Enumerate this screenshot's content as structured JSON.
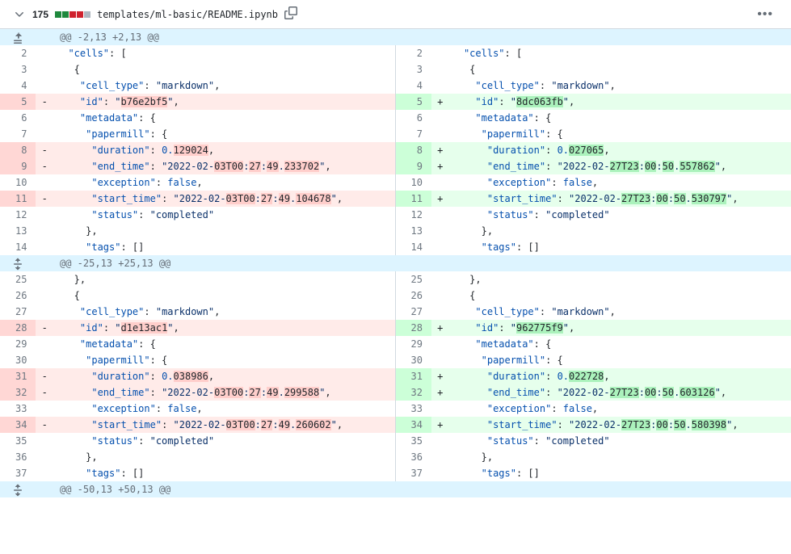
{
  "header": {
    "change_count": "175",
    "file_path": "templates/ml-basic/README.ipynb",
    "diffstat": [
      "add",
      "add",
      "del",
      "del",
      "neu"
    ]
  },
  "hunks": [
    {
      "label": "@@ -2,13 +2,13 @@",
      "expand_kind": "up",
      "rows": [
        {
          "l": 2,
          "r": 2,
          "t": "ctx",
          "tok": [
            [
              "w",
              "  "
            ],
            [
              "k",
              "\"cells\""
            ],
            [
              "p",
              ": ["
            ]
          ]
        },
        {
          "l": 3,
          "r": 3,
          "t": "ctx",
          "tok": [
            [
              "w",
              "   "
            ],
            [
              "p",
              "{"
            ]
          ]
        },
        {
          "l": 4,
          "r": 4,
          "t": "ctx",
          "tok": [
            [
              "w",
              "    "
            ],
            [
              "k",
              "\"cell_type\""
            ],
            [
              "p",
              ": "
            ],
            [
              "s",
              "\"markdown\""
            ],
            [
              "p",
              ","
            ]
          ]
        },
        {
          "l": 5,
          "r": 5,
          "t": "chg",
          "lt": [
            [
              "w",
              "    "
            ],
            [
              "k",
              "\"id\""
            ],
            [
              "p",
              ": "
            ],
            [
              "s",
              "\""
            ],
            [
              "hd",
              "b76e2bf5"
            ],
            [
              "s",
              "\""
            ],
            [
              "p",
              ","
            ]
          ],
          "rt": [
            [
              "w",
              "    "
            ],
            [
              "k",
              "\"id\""
            ],
            [
              "p",
              ": "
            ],
            [
              "s",
              "\""
            ],
            [
              "ha",
              "8dc063fb"
            ],
            [
              "s",
              "\""
            ],
            [
              "p",
              ","
            ]
          ]
        },
        {
          "l": 6,
          "r": 6,
          "t": "ctx",
          "tok": [
            [
              "w",
              "    "
            ],
            [
              "k",
              "\"metadata\""
            ],
            [
              "p",
              ": {"
            ]
          ]
        },
        {
          "l": 7,
          "r": 7,
          "t": "ctx",
          "tok": [
            [
              "w",
              "     "
            ],
            [
              "k",
              "\"papermill\""
            ],
            [
              "p",
              ": {"
            ]
          ]
        },
        {
          "l": 8,
          "r": 8,
          "t": "chg",
          "lt": [
            [
              "w",
              "      "
            ],
            [
              "k",
              "\"duration\""
            ],
            [
              "p",
              ": "
            ],
            [
              "n",
              "0."
            ],
            [
              "hd",
              "129024"
            ],
            [
              "p",
              ","
            ]
          ],
          "rt": [
            [
              "w",
              "      "
            ],
            [
              "k",
              "\"duration\""
            ],
            [
              "p",
              ": "
            ],
            [
              "n",
              "0."
            ],
            [
              "ha",
              "027065"
            ],
            [
              "p",
              ","
            ]
          ]
        },
        {
          "l": 9,
          "r": 9,
          "t": "chg",
          "lt": [
            [
              "w",
              "      "
            ],
            [
              "k",
              "\"end_time\""
            ],
            [
              "p",
              ": "
            ],
            [
              "s",
              "\"2022-02-"
            ],
            [
              "hd",
              "03T00"
            ],
            [
              "s",
              ":"
            ],
            [
              "hd",
              "27"
            ],
            [
              "s",
              ":"
            ],
            [
              "hd",
              "49"
            ],
            [
              "s",
              "."
            ],
            [
              "hd",
              "233702"
            ],
            [
              "s",
              "\""
            ],
            [
              "p",
              ","
            ]
          ],
          "rt": [
            [
              "w",
              "      "
            ],
            [
              "k",
              "\"end_time\""
            ],
            [
              "p",
              ": "
            ],
            [
              "s",
              "\"2022-02-"
            ],
            [
              "ha",
              "27T23"
            ],
            [
              "s",
              ":"
            ],
            [
              "ha",
              "00"
            ],
            [
              "s",
              ":"
            ],
            [
              "ha",
              "50"
            ],
            [
              "s",
              "."
            ],
            [
              "ha",
              "557862"
            ],
            [
              "s",
              "\""
            ],
            [
              "p",
              ","
            ]
          ]
        },
        {
          "l": 10,
          "r": 10,
          "t": "ctx",
          "tok": [
            [
              "w",
              "      "
            ],
            [
              "k",
              "\"exception\""
            ],
            [
              "p",
              ": "
            ],
            [
              "b",
              "false"
            ],
            [
              "p",
              ","
            ]
          ]
        },
        {
          "l": 11,
          "r": 11,
          "t": "chg",
          "lt": [
            [
              "w",
              "      "
            ],
            [
              "k",
              "\"start_time\""
            ],
            [
              "p",
              ": "
            ],
            [
              "s",
              "\"2022-02-"
            ],
            [
              "hd",
              "03T00"
            ],
            [
              "s",
              ":"
            ],
            [
              "hd",
              "27"
            ],
            [
              "s",
              ":"
            ],
            [
              "hd",
              "49"
            ],
            [
              "s",
              "."
            ],
            [
              "hd",
              "104678"
            ],
            [
              "s",
              "\""
            ],
            [
              "p",
              ","
            ]
          ],
          "rt": [
            [
              "w",
              "      "
            ],
            [
              "k",
              "\"start_time\""
            ],
            [
              "p",
              ": "
            ],
            [
              "s",
              "\"2022-02-"
            ],
            [
              "ha",
              "27T23"
            ],
            [
              "s",
              ":"
            ],
            [
              "ha",
              "00"
            ],
            [
              "s",
              ":"
            ],
            [
              "ha",
              "50"
            ],
            [
              "s",
              "."
            ],
            [
              "ha",
              "530797"
            ],
            [
              "s",
              "\""
            ],
            [
              "p",
              ","
            ]
          ]
        },
        {
          "l": 12,
          "r": 12,
          "t": "ctx",
          "tok": [
            [
              "w",
              "      "
            ],
            [
              "k",
              "\"status\""
            ],
            [
              "p",
              ": "
            ],
            [
              "s",
              "\"completed\""
            ]
          ]
        },
        {
          "l": 13,
          "r": 13,
          "t": "ctx",
          "tok": [
            [
              "w",
              "     "
            ],
            [
              "p",
              "},"
            ]
          ]
        },
        {
          "l": 14,
          "r": 14,
          "t": "ctx",
          "tok": [
            [
              "w",
              "     "
            ],
            [
              "k",
              "\"tags\""
            ],
            [
              "p",
              ": []"
            ]
          ]
        }
      ]
    },
    {
      "label": "@@ -25,13 +25,13 @@",
      "expand_kind": "both",
      "rows": [
        {
          "l": 25,
          "r": 25,
          "t": "ctx",
          "tok": [
            [
              "w",
              "   "
            ],
            [
              "p",
              "},"
            ]
          ]
        },
        {
          "l": 26,
          "r": 26,
          "t": "ctx",
          "tok": [
            [
              "w",
              "   "
            ],
            [
              "p",
              "{"
            ]
          ]
        },
        {
          "l": 27,
          "r": 27,
          "t": "ctx",
          "tok": [
            [
              "w",
              "    "
            ],
            [
              "k",
              "\"cell_type\""
            ],
            [
              "p",
              ": "
            ],
            [
              "s",
              "\"markdown\""
            ],
            [
              "p",
              ","
            ]
          ]
        },
        {
          "l": 28,
          "r": 28,
          "t": "chg",
          "lt": [
            [
              "w",
              "    "
            ],
            [
              "k",
              "\"id\""
            ],
            [
              "p",
              ": "
            ],
            [
              "s",
              "\""
            ],
            [
              "hd",
              "d1e13ac1"
            ],
            [
              "s",
              "\""
            ],
            [
              "p",
              ","
            ]
          ],
          "rt": [
            [
              "w",
              "    "
            ],
            [
              "k",
              "\"id\""
            ],
            [
              "p",
              ": "
            ],
            [
              "s",
              "\""
            ],
            [
              "ha",
              "962775f9"
            ],
            [
              "s",
              "\""
            ],
            [
              "p",
              ","
            ]
          ]
        },
        {
          "l": 29,
          "r": 29,
          "t": "ctx",
          "tok": [
            [
              "w",
              "    "
            ],
            [
              "k",
              "\"metadata\""
            ],
            [
              "p",
              ": {"
            ]
          ]
        },
        {
          "l": 30,
          "r": 30,
          "t": "ctx",
          "tok": [
            [
              "w",
              "     "
            ],
            [
              "k",
              "\"papermill\""
            ],
            [
              "p",
              ": {"
            ]
          ]
        },
        {
          "l": 31,
          "r": 31,
          "t": "chg",
          "lt": [
            [
              "w",
              "      "
            ],
            [
              "k",
              "\"duration\""
            ],
            [
              "p",
              ": "
            ],
            [
              "n",
              "0."
            ],
            [
              "hd",
              "038986"
            ],
            [
              "p",
              ","
            ]
          ],
          "rt": [
            [
              "w",
              "      "
            ],
            [
              "k",
              "\"duration\""
            ],
            [
              "p",
              ": "
            ],
            [
              "n",
              "0."
            ],
            [
              "ha",
              "022728"
            ],
            [
              "p",
              ","
            ]
          ]
        },
        {
          "l": 32,
          "r": 32,
          "t": "chg",
          "lt": [
            [
              "w",
              "      "
            ],
            [
              "k",
              "\"end_time\""
            ],
            [
              "p",
              ": "
            ],
            [
              "s",
              "\"2022-02-"
            ],
            [
              "hd",
              "03T00"
            ],
            [
              "s",
              ":"
            ],
            [
              "hd",
              "27"
            ],
            [
              "s",
              ":"
            ],
            [
              "hd",
              "49"
            ],
            [
              "s",
              "."
            ],
            [
              "hd",
              "299588"
            ],
            [
              "s",
              "\""
            ],
            [
              "p",
              ","
            ]
          ],
          "rt": [
            [
              "w",
              "      "
            ],
            [
              "k",
              "\"end_time\""
            ],
            [
              "p",
              ": "
            ],
            [
              "s",
              "\"2022-02-"
            ],
            [
              "ha",
              "27T23"
            ],
            [
              "s",
              ":"
            ],
            [
              "ha",
              "00"
            ],
            [
              "s",
              ":"
            ],
            [
              "ha",
              "50"
            ],
            [
              "s",
              "."
            ],
            [
              "ha",
              "603126"
            ],
            [
              "s",
              "\""
            ],
            [
              "p",
              ","
            ]
          ]
        },
        {
          "l": 33,
          "r": 33,
          "t": "ctx",
          "tok": [
            [
              "w",
              "      "
            ],
            [
              "k",
              "\"exception\""
            ],
            [
              "p",
              ": "
            ],
            [
              "b",
              "false"
            ],
            [
              "p",
              ","
            ]
          ]
        },
        {
          "l": 34,
          "r": 34,
          "t": "chg",
          "lt": [
            [
              "w",
              "      "
            ],
            [
              "k",
              "\"start_time\""
            ],
            [
              "p",
              ": "
            ],
            [
              "s",
              "\"2022-02-"
            ],
            [
              "hd",
              "03T00"
            ],
            [
              "s",
              ":"
            ],
            [
              "hd",
              "27"
            ],
            [
              "s",
              ":"
            ],
            [
              "hd",
              "49"
            ],
            [
              "s",
              "."
            ],
            [
              "hd",
              "260602"
            ],
            [
              "s",
              "\""
            ],
            [
              "p",
              ","
            ]
          ],
          "rt": [
            [
              "w",
              "      "
            ],
            [
              "k",
              "\"start_time\""
            ],
            [
              "p",
              ": "
            ],
            [
              "s",
              "\"2022-02-"
            ],
            [
              "ha",
              "27T23"
            ],
            [
              "s",
              ":"
            ],
            [
              "ha",
              "00"
            ],
            [
              "s",
              ":"
            ],
            [
              "ha",
              "50"
            ],
            [
              "s",
              "."
            ],
            [
              "ha",
              "580398"
            ],
            [
              "s",
              "\""
            ],
            [
              "p",
              ","
            ]
          ]
        },
        {
          "l": 35,
          "r": 35,
          "t": "ctx",
          "tok": [
            [
              "w",
              "      "
            ],
            [
              "k",
              "\"status\""
            ],
            [
              "p",
              ": "
            ],
            [
              "s",
              "\"completed\""
            ]
          ]
        },
        {
          "l": 36,
          "r": 36,
          "t": "ctx",
          "tok": [
            [
              "w",
              "     "
            ],
            [
              "p",
              "},"
            ]
          ]
        },
        {
          "l": 37,
          "r": 37,
          "t": "ctx",
          "tok": [
            [
              "w",
              "     "
            ],
            [
              "k",
              "\"tags\""
            ],
            [
              "p",
              ": []"
            ]
          ]
        }
      ]
    },
    {
      "label": "@@ -50,13 +50,13 @@",
      "expand_kind": "both",
      "rows": []
    }
  ]
}
